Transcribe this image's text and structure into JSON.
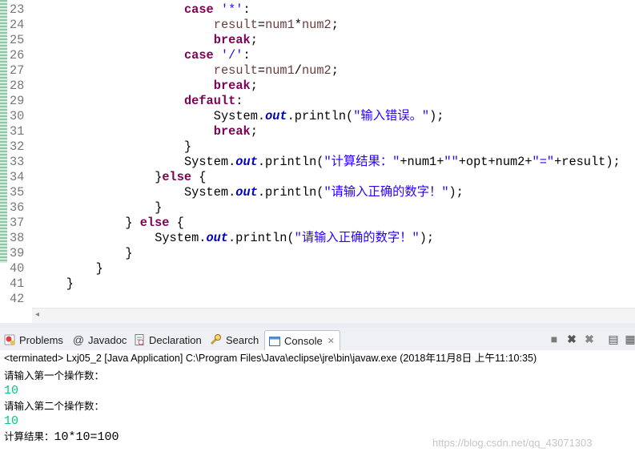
{
  "editor": {
    "lines": [
      {
        "num": "23",
        "indent": 20,
        "tokens": [
          {
            "t": "case",
            "c": "kw"
          },
          {
            "t": " "
          },
          {
            "t": "'*'",
            "c": "str"
          },
          {
            "t": ":"
          }
        ]
      },
      {
        "num": "24",
        "indent": 24,
        "tokens": [
          {
            "t": "result",
            "c": "var"
          },
          {
            "t": "="
          },
          {
            "t": "num1",
            "c": "var"
          },
          {
            "t": "*"
          },
          {
            "t": "num2",
            "c": "var"
          },
          {
            "t": ";"
          }
        ]
      },
      {
        "num": "25",
        "indent": 24,
        "tokens": [
          {
            "t": "break",
            "c": "kw"
          },
          {
            "t": ";"
          }
        ]
      },
      {
        "num": "26",
        "indent": 20,
        "tokens": [
          {
            "t": "case",
            "c": "kw"
          },
          {
            "t": " "
          },
          {
            "t": "'/'",
            "c": "str"
          },
          {
            "t": ":"
          }
        ]
      },
      {
        "num": "27",
        "indent": 24,
        "tokens": [
          {
            "t": "result",
            "c": "var"
          },
          {
            "t": "="
          },
          {
            "t": "num1",
            "c": "var"
          },
          {
            "t": "/"
          },
          {
            "t": "num2",
            "c": "var"
          },
          {
            "t": ";"
          }
        ]
      },
      {
        "num": "28",
        "indent": 24,
        "tokens": [
          {
            "t": "break",
            "c": "kw"
          },
          {
            "t": ";"
          }
        ]
      },
      {
        "num": "29",
        "indent": 20,
        "tokens": [
          {
            "t": "default",
            "c": "kw"
          },
          {
            "t": ":"
          }
        ]
      },
      {
        "num": "30",
        "indent": 24,
        "tokens": [
          {
            "t": "System."
          },
          {
            "t": "out",
            "c": "fld"
          },
          {
            "t": ".println("
          },
          {
            "t": "\"",
            "c": "str"
          },
          {
            "t": "输入错误。",
            "c": "str cjk"
          },
          {
            "t": "\"",
            "c": "str"
          },
          {
            "t": ");"
          }
        ]
      },
      {
        "num": "31",
        "indent": 24,
        "tokens": [
          {
            "t": "break",
            "c": "kw"
          },
          {
            "t": ";"
          }
        ]
      },
      {
        "num": "32",
        "indent": 20,
        "tokens": [
          {
            "t": "}"
          }
        ]
      },
      {
        "num": "33",
        "indent": 20,
        "tokens": [
          {
            "t": "System."
          },
          {
            "t": "out",
            "c": "fld"
          },
          {
            "t": ".println("
          },
          {
            "t": "\"",
            "c": "str"
          },
          {
            "t": "计算结果：",
            "c": "str cjk"
          },
          {
            "t": "\"",
            "c": "str"
          },
          {
            "t": "+num1+"
          },
          {
            "t": "\"\"",
            "c": "str"
          },
          {
            "t": "+opt+num2+"
          },
          {
            "t": "\"=\"",
            "c": "str"
          },
          {
            "t": "+result);"
          }
        ]
      },
      {
        "num": "34",
        "indent": 16,
        "tokens": [
          {
            "t": "}"
          },
          {
            "t": "else",
            "c": "kw"
          },
          {
            "t": " {"
          }
        ]
      },
      {
        "num": "35",
        "indent": 20,
        "tokens": [
          {
            "t": "System."
          },
          {
            "t": "out",
            "c": "fld"
          },
          {
            "t": ".println("
          },
          {
            "t": "\"",
            "c": "str"
          },
          {
            "t": "请输入正确的数字！",
            "c": "str cjk"
          },
          {
            "t": "\"",
            "c": "str"
          },
          {
            "t": ");"
          }
        ]
      },
      {
        "num": "36",
        "indent": 16,
        "tokens": [
          {
            "t": "}"
          }
        ]
      },
      {
        "num": "37",
        "indent": 12,
        "tokens": [
          {
            "t": "} "
          },
          {
            "t": "else",
            "c": "kw"
          },
          {
            "t": " {"
          }
        ]
      },
      {
        "num": "38",
        "indent": 16,
        "tokens": [
          {
            "t": "System."
          },
          {
            "t": "out",
            "c": "fld"
          },
          {
            "t": ".println("
          },
          {
            "t": "\"",
            "c": "str"
          },
          {
            "t": "请输入正确的数字！",
            "c": "str cjk"
          },
          {
            "t": "\"",
            "c": "str"
          },
          {
            "t": ");"
          }
        ]
      },
      {
        "num": "39",
        "indent": 12,
        "tokens": [
          {
            "t": "}"
          }
        ]
      },
      {
        "num": "40",
        "indent": 8,
        "tokens": [
          {
            "t": "}"
          }
        ]
      },
      {
        "num": "41",
        "indent": 4,
        "tokens": [
          {
            "t": "}"
          }
        ]
      },
      {
        "num": "42",
        "indent": 0,
        "tokens": []
      }
    ]
  },
  "tabs": [
    {
      "label": "Problems",
      "icon": "problems-icon"
    },
    {
      "label": "Javadoc",
      "icon": "at-icon"
    },
    {
      "label": "Declaration",
      "icon": "declaration-icon"
    },
    {
      "label": "Search",
      "icon": "search-icon"
    },
    {
      "label": "Console",
      "icon": "console-icon",
      "active": true
    }
  ],
  "console": {
    "header": "<terminated> Lxj05_2 [Java Application] C:\\Program Files\\Java\\eclipse\\jre\\bin\\javaw.exe (2018年11月8日 上午11:10:35)",
    "lines": [
      {
        "kind": "out",
        "text": "请输入第一个操作数："
      },
      {
        "kind": "in",
        "text": "10"
      },
      {
        "kind": "out",
        "text": "请输入第二个操作数："
      },
      {
        "kind": "in",
        "text": "10"
      },
      {
        "kind": "mix",
        "label": "计算结果：",
        "value": "10*10=100"
      }
    ]
  },
  "watermark": "https://blog.csdn.net/qq_43071303",
  "colors": {
    "keyword": "#7f0055",
    "string": "#2a00ff",
    "field": "#0000c0",
    "input": "#00c87d"
  }
}
